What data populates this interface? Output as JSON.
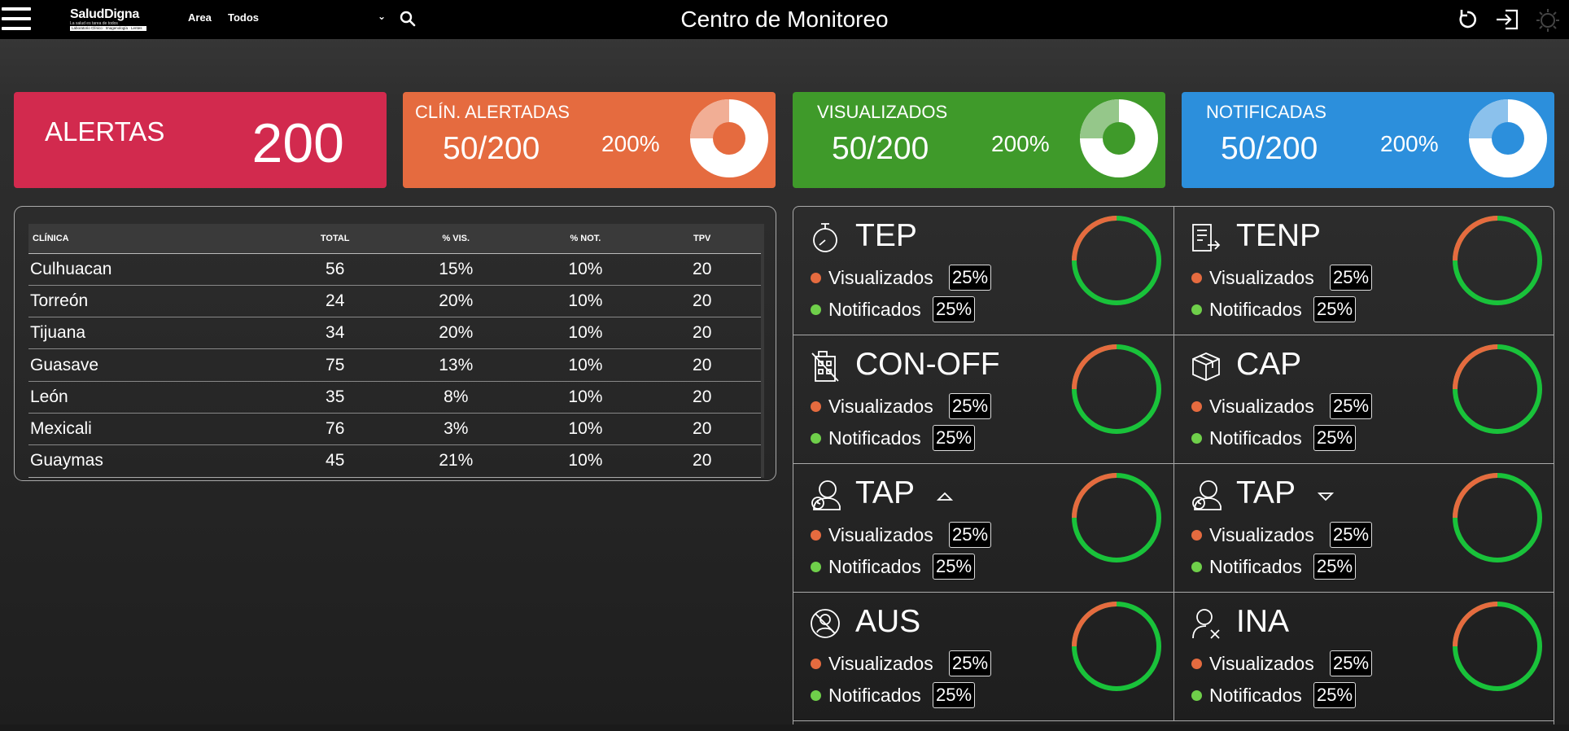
{
  "header": {
    "title": "Centro de Monitoreo",
    "logo": {
      "brand": "SaludDigna",
      "tagline": "La salud es tarea de todos",
      "sub": "Laboratorio Clínico · Imagenología · Lentes"
    },
    "area_label": "Area",
    "area_value": "Todos"
  },
  "kpis": {
    "alertas": {
      "label": "ALERTAS",
      "value": "200",
      "color": "#d22a4e"
    },
    "clinicas": {
      "title": "CLÍN. ALERTADAS",
      "ratio": "50/200",
      "percent": "200%",
      "fraction": 0.25,
      "color": "#e56b3f"
    },
    "visualizados": {
      "title": "VISUALIZADOS",
      "ratio": "50/200",
      "percent": "200%",
      "fraction": 0.25,
      "color": "#3f9a2a"
    },
    "notificadas": {
      "title": "NOTIFICADAS",
      "ratio": "50/200",
      "percent": "200%",
      "fraction": 0.25,
      "color": "#2c8fdc"
    }
  },
  "table": {
    "headers": [
      "CLÍNICA",
      "TOTAL",
      "% VIS.",
      "% NOT.",
      "TPV"
    ],
    "rows": [
      [
        "Culhuacan",
        "56",
        "15%",
        "10%",
        "20"
      ],
      [
        "Torreón",
        "24",
        "20%",
        "10%",
        "20"
      ],
      [
        "Tijuana",
        "34",
        "20%",
        "10%",
        "20"
      ],
      [
        "Guasave",
        "75",
        "13%",
        "10%",
        "20"
      ],
      [
        "León",
        "35",
        "8%",
        "10%",
        "20"
      ],
      [
        "Mexicali",
        "76",
        "3%",
        "10%",
        "20"
      ],
      [
        "Guaymas",
        "45",
        "21%",
        "10%",
        "20"
      ]
    ]
  },
  "metrics": {
    "vis_label": "Visualizados",
    "not_label": "Notificados",
    "colors": {
      "visualizados": "#e56b3f",
      "notificados": "#6fcf4a",
      "ring_main": "#19c23a",
      "ring_accent": "#e56b3f"
    },
    "cells": [
      {
        "title": "TEP",
        "icon": "stopwatch-icon",
        "vis": "25%",
        "not": "25%",
        "ring_fraction": 0.25
      },
      {
        "title": "TENP",
        "icon": "document-export-icon",
        "vis": "25%",
        "not": "25%",
        "ring_fraction": 0.25
      },
      {
        "title": "CON-OFF",
        "icon": "building-off-icon",
        "vis": "25%",
        "not": "25%",
        "ring_fraction": 0.25
      },
      {
        "title": "CAP",
        "icon": "boxes-icon",
        "vis": "25%",
        "not": "25%",
        "ring_fraction": 0.25
      },
      {
        "title": "TAP",
        "icon": "user-clock-icon",
        "arrow": "up",
        "vis": "25%",
        "not": "25%",
        "ring_fraction": 0.25
      },
      {
        "title": "TAP",
        "icon": "user-clock-icon",
        "arrow": "down",
        "vis": "25%",
        "not": "25%",
        "ring_fraction": 0.25
      },
      {
        "title": "AUS",
        "icon": "user-absent-icon",
        "vis": "25%",
        "not": "25%",
        "ring_fraction": 0.25
      },
      {
        "title": "INA",
        "icon": "user-x-icon",
        "vis": "25%",
        "not": "25%",
        "ring_fraction": 0.25
      }
    ]
  }
}
